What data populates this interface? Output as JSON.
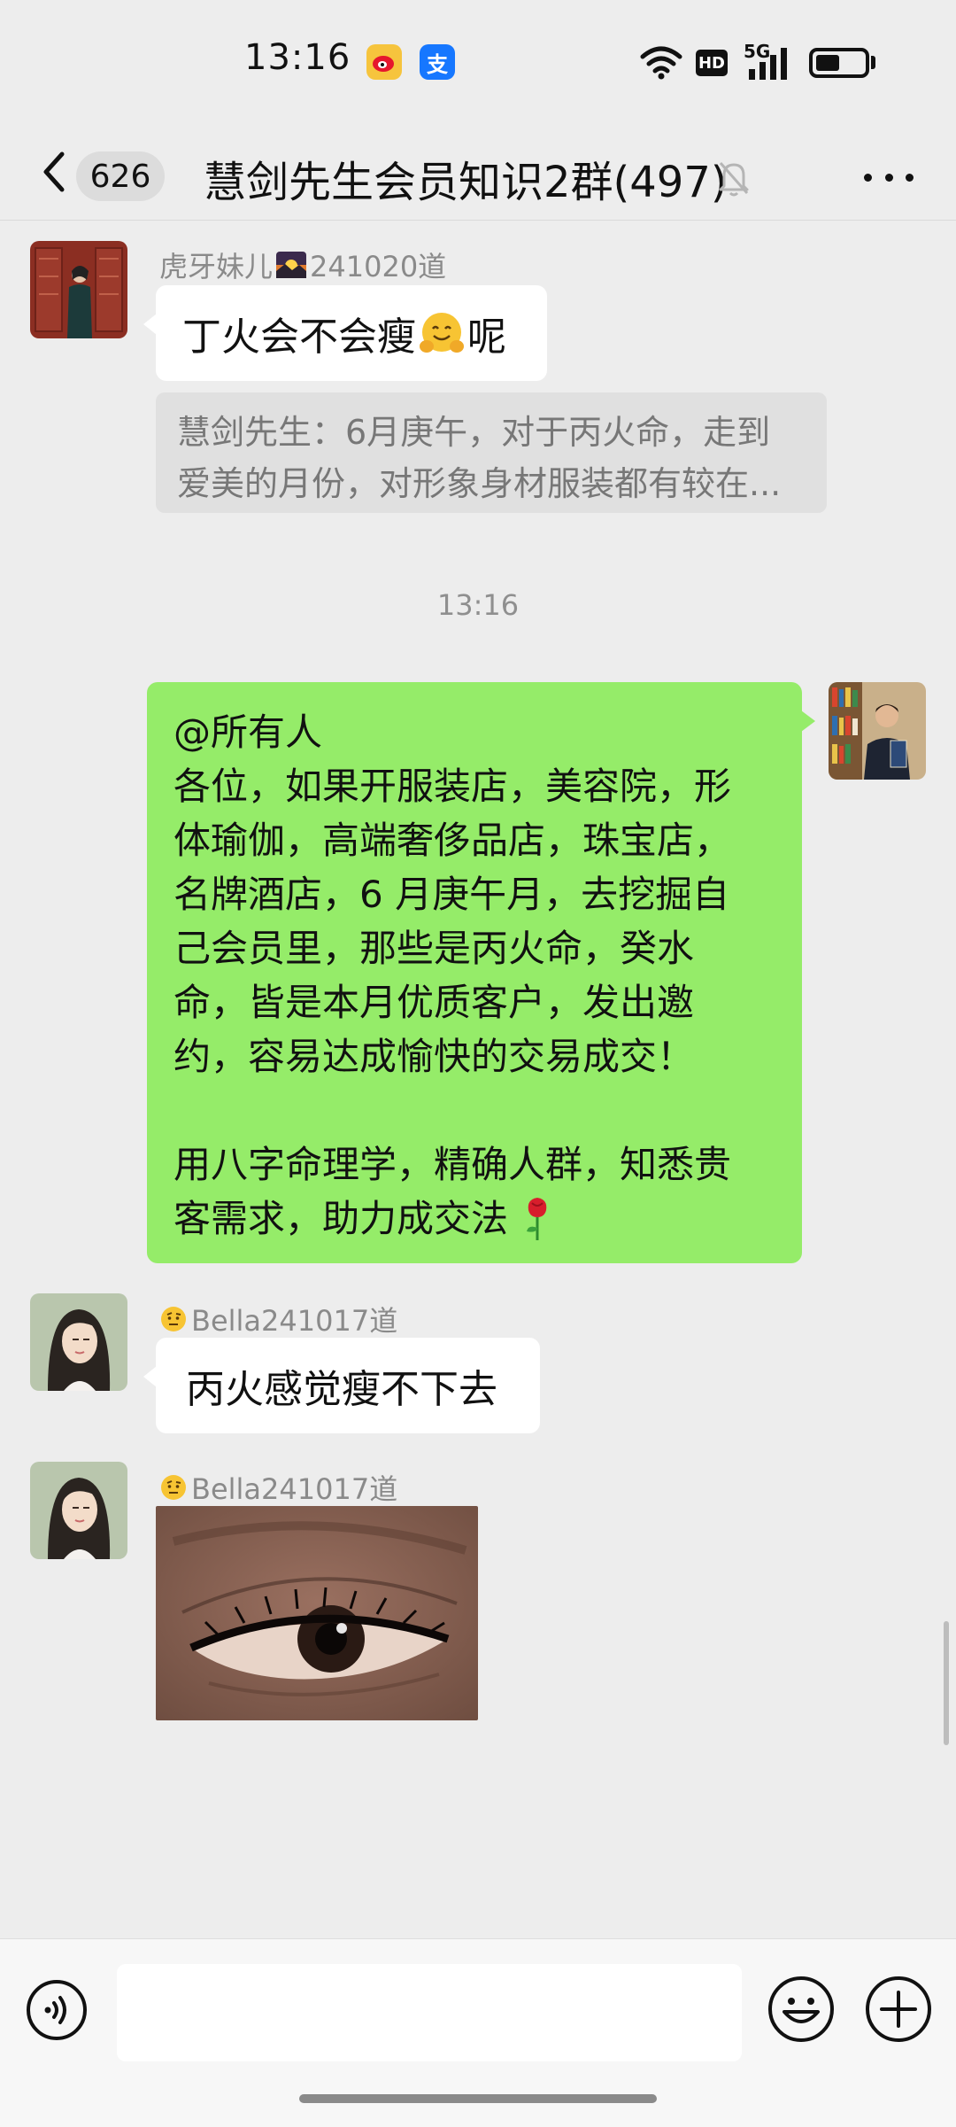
{
  "status_bar": {
    "time": "13:16",
    "weibo_icon": "weibo-app-icon",
    "alipay_label": "支",
    "hd_label": "HD",
    "network_label": "5G",
    "battery_level": 0.5
  },
  "header": {
    "unread_count": "626",
    "title": "慧剑先生会员知识2群(497)"
  },
  "messages": [
    {
      "sender": "虎牙妹儿",
      "sender_suffix": "241020道",
      "text_before": "丁火会不会瘦",
      "text_after": "呢",
      "quote_lines": [
        "慧剑先生：6月庚午，对于丙火命，走到",
        "爱美的月份，对形象身材服装都有较在..."
      ]
    },
    {
      "time_divider": "13:16"
    },
    {
      "self": true,
      "lines": [
        "@所有人",
        "各位，如果开服装店，美容院，形",
        "体瑜伽，高端奢侈品店，珠宝店，",
        "名牌酒店，6 月庚午月，去挖掘自",
        "己会员里，那些是丙火命，癸水",
        "命，皆是本月优质客户，发出邀",
        "约，容易达成愉快的交易成交！",
        "",
        "用八字命理学，精确人群，知悉贵",
        "客需求，助力成交法"
      ]
    },
    {
      "sender": "Bella241017道",
      "text": "丙火感觉瘦不下去"
    },
    {
      "sender": "Bella241017道",
      "image": "eye-closeup-photo"
    }
  ],
  "input": {
    "placeholder": ""
  },
  "colors": {
    "background": "#ededed",
    "self_bubble": "#95ec69",
    "other_bubble": "#ffffff"
  }
}
